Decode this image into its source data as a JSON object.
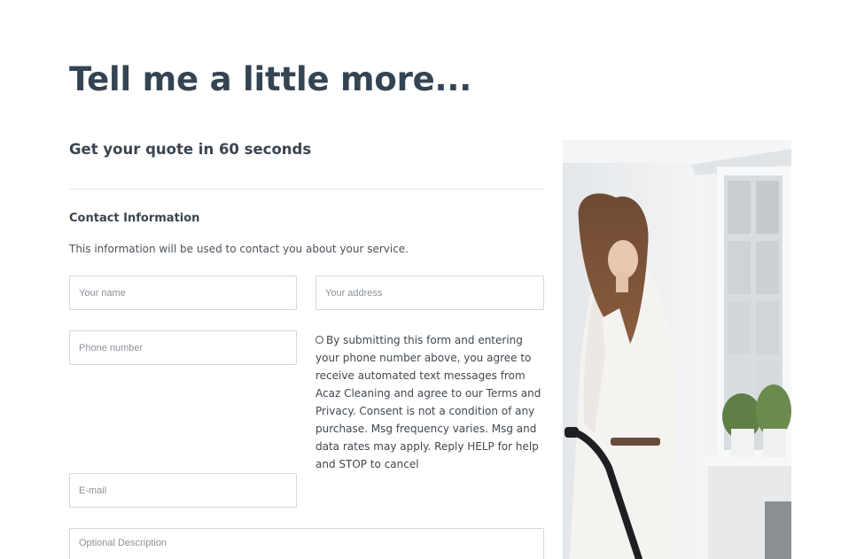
{
  "header": {
    "title": "Tell me a little more...",
    "subtitle": "Get your quote in 60 seconds"
  },
  "contact": {
    "section_title": "Contact Information",
    "description": "This information will be used to contact you about your service."
  },
  "fields": {
    "name_placeholder": "Your name",
    "address_placeholder": "Your address",
    "phone_placeholder": "Phone number",
    "email_placeholder": "E-mail",
    "description_placeholder": "Optional Description"
  },
  "consent": {
    "text": "By submitting this form and entering your phone number above, you agree to receive automated text messages from Acaz Cleaning and agree to our Terms and Privacy. Consent is not a condition of any purchase. Msg frequency varies. Msg and data rates may apply. Reply HELP for help and STOP to cancel"
  },
  "colors": {
    "heading": "#354452",
    "border": "#d3d7db"
  }
}
